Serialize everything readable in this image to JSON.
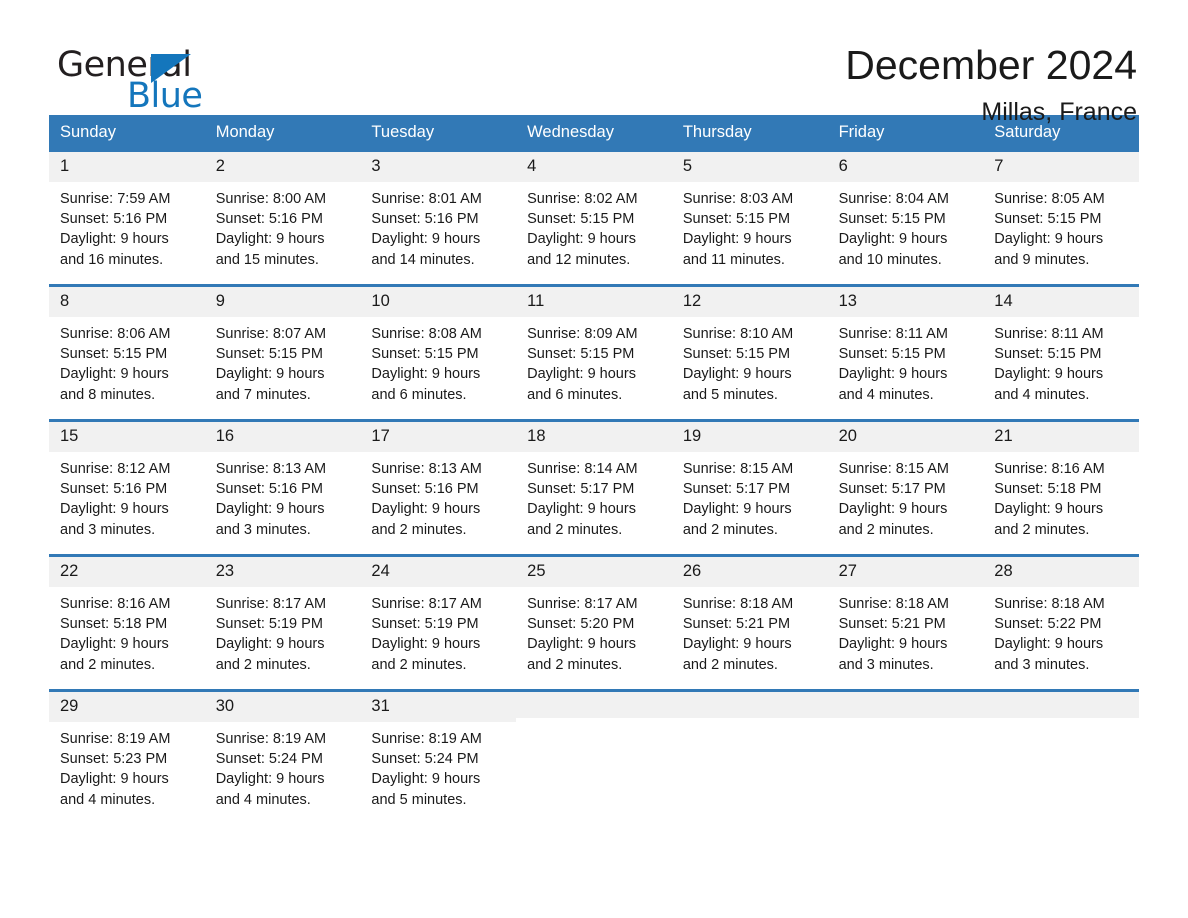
{
  "brand": {
    "name_part1": "General",
    "name_part2": "Blue",
    "logo_icon": "triangle-logo-icon",
    "accent_color": "#1476bc"
  },
  "header": {
    "month_title": "December 2024",
    "location": "Millas, France",
    "header_bg_color": "#3279b6",
    "day_strip_color": "#f1f1f1"
  },
  "weekdays": [
    "Sunday",
    "Monday",
    "Tuesday",
    "Wednesday",
    "Thursday",
    "Friday",
    "Saturday"
  ],
  "weeks": [
    {
      "days": [
        {
          "num": "1",
          "info": "Sunrise: 7:59 AM\nSunset: 5:16 PM\nDaylight: 9 hours\nand 16 minutes."
        },
        {
          "num": "2",
          "info": "Sunrise: 8:00 AM\nSunset: 5:16 PM\nDaylight: 9 hours\nand 15 minutes."
        },
        {
          "num": "3",
          "info": "Sunrise: 8:01 AM\nSunset: 5:16 PM\nDaylight: 9 hours\nand 14 minutes."
        },
        {
          "num": "4",
          "info": "Sunrise: 8:02 AM\nSunset: 5:15 PM\nDaylight: 9 hours\nand 12 minutes."
        },
        {
          "num": "5",
          "info": "Sunrise: 8:03 AM\nSunset: 5:15 PM\nDaylight: 9 hours\nand 11 minutes."
        },
        {
          "num": "6",
          "info": "Sunrise: 8:04 AM\nSunset: 5:15 PM\nDaylight: 9 hours\nand 10 minutes."
        },
        {
          "num": "7",
          "info": "Sunrise: 8:05 AM\nSunset: 5:15 PM\nDaylight: 9 hours\nand 9 minutes."
        }
      ]
    },
    {
      "days": [
        {
          "num": "8",
          "info": "Sunrise: 8:06 AM\nSunset: 5:15 PM\nDaylight: 9 hours\nand 8 minutes."
        },
        {
          "num": "9",
          "info": "Sunrise: 8:07 AM\nSunset: 5:15 PM\nDaylight: 9 hours\nand 7 minutes."
        },
        {
          "num": "10",
          "info": "Sunrise: 8:08 AM\nSunset: 5:15 PM\nDaylight: 9 hours\nand 6 minutes."
        },
        {
          "num": "11",
          "info": "Sunrise: 8:09 AM\nSunset: 5:15 PM\nDaylight: 9 hours\nand 6 minutes."
        },
        {
          "num": "12",
          "info": "Sunrise: 8:10 AM\nSunset: 5:15 PM\nDaylight: 9 hours\nand 5 minutes."
        },
        {
          "num": "13",
          "info": "Sunrise: 8:11 AM\nSunset: 5:15 PM\nDaylight: 9 hours\nand 4 minutes."
        },
        {
          "num": "14",
          "info": "Sunrise: 8:11 AM\nSunset: 5:15 PM\nDaylight: 9 hours\nand 4 minutes."
        }
      ]
    },
    {
      "days": [
        {
          "num": "15",
          "info": "Sunrise: 8:12 AM\nSunset: 5:16 PM\nDaylight: 9 hours\nand 3 minutes."
        },
        {
          "num": "16",
          "info": "Sunrise: 8:13 AM\nSunset: 5:16 PM\nDaylight: 9 hours\nand 3 minutes."
        },
        {
          "num": "17",
          "info": "Sunrise: 8:13 AM\nSunset: 5:16 PM\nDaylight: 9 hours\nand 2 minutes."
        },
        {
          "num": "18",
          "info": "Sunrise: 8:14 AM\nSunset: 5:17 PM\nDaylight: 9 hours\nand 2 minutes."
        },
        {
          "num": "19",
          "info": "Sunrise: 8:15 AM\nSunset: 5:17 PM\nDaylight: 9 hours\nand 2 minutes."
        },
        {
          "num": "20",
          "info": "Sunrise: 8:15 AM\nSunset: 5:17 PM\nDaylight: 9 hours\nand 2 minutes."
        },
        {
          "num": "21",
          "info": "Sunrise: 8:16 AM\nSunset: 5:18 PM\nDaylight: 9 hours\nand 2 minutes."
        }
      ]
    },
    {
      "days": [
        {
          "num": "22",
          "info": "Sunrise: 8:16 AM\nSunset: 5:18 PM\nDaylight: 9 hours\nand 2 minutes."
        },
        {
          "num": "23",
          "info": "Sunrise: 8:17 AM\nSunset: 5:19 PM\nDaylight: 9 hours\nand 2 minutes."
        },
        {
          "num": "24",
          "info": "Sunrise: 8:17 AM\nSunset: 5:19 PM\nDaylight: 9 hours\nand 2 minutes."
        },
        {
          "num": "25",
          "info": "Sunrise: 8:17 AM\nSunset: 5:20 PM\nDaylight: 9 hours\nand 2 minutes."
        },
        {
          "num": "26",
          "info": "Sunrise: 8:18 AM\nSunset: 5:21 PM\nDaylight: 9 hours\nand 2 minutes."
        },
        {
          "num": "27",
          "info": "Sunrise: 8:18 AM\nSunset: 5:21 PM\nDaylight: 9 hours\nand 3 minutes."
        },
        {
          "num": "28",
          "info": "Sunrise: 8:18 AM\nSunset: 5:22 PM\nDaylight: 9 hours\nand 3 minutes."
        }
      ]
    },
    {
      "days": [
        {
          "num": "29",
          "info": "Sunrise: 8:19 AM\nSunset: 5:23 PM\nDaylight: 9 hours\nand 4 minutes."
        },
        {
          "num": "30",
          "info": "Sunrise: 8:19 AM\nSunset: 5:24 PM\nDaylight: 9 hours\nand 4 minutes."
        },
        {
          "num": "31",
          "info": "Sunrise: 8:19 AM\nSunset: 5:24 PM\nDaylight: 9 hours\nand 5 minutes."
        },
        {
          "num": "",
          "info": ""
        },
        {
          "num": "",
          "info": ""
        },
        {
          "num": "",
          "info": ""
        },
        {
          "num": "",
          "info": ""
        }
      ]
    }
  ]
}
